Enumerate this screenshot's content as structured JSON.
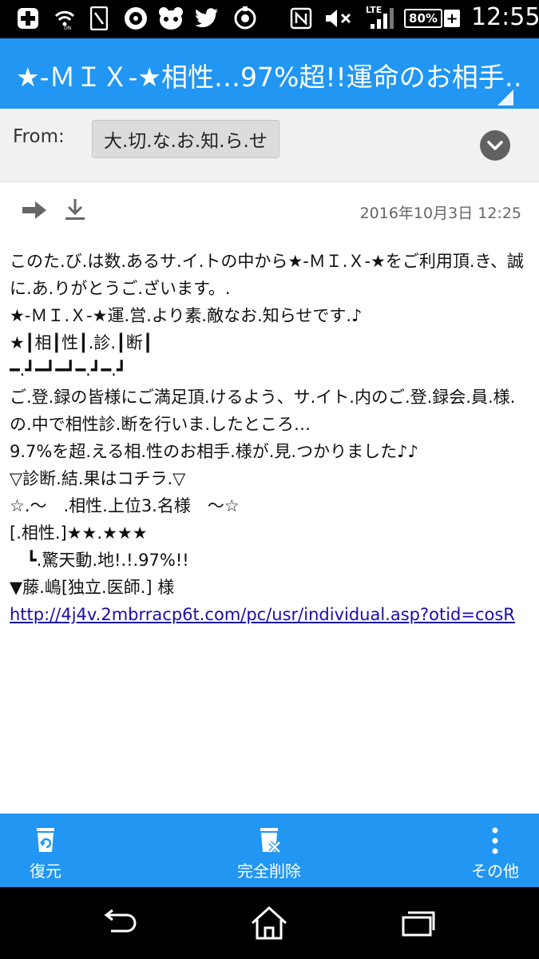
{
  "status_bar": {
    "time": "12:55",
    "battery": "80%",
    "network": "LTE",
    "icons": [
      "plus-icon",
      "wifi-on-icon",
      "sim-card-icon",
      "app-icon",
      "panda-icon",
      "twitter-icon",
      "sync-icon",
      "nfc-icon",
      "mute-icon",
      "signal-icon",
      "battery-icon",
      "charging-icon"
    ]
  },
  "header": {
    "subject": "★-ＭＩＸ-★相性…97%超!!運命のお相手…"
  },
  "from": {
    "label": "From:",
    "sender": "大.切.な.お.知.ら.せ"
  },
  "meta": {
    "date": "2016年10月3日 12:25"
  },
  "body": {
    "lines": [
      "このた.び.は数.あるサ.イ.トの中から★-ＭＩ.Ｘ-★をご利用頂.き、誠に.あ.りがとうご.ざいます。.",
      "",
      "★-ＭＩ.Ｘ-★運.営.より素.敵なお.知らせです.♪",
      "",
      "★┃相┃性┃.診.┃断┃",
      "━.┛━┛━┛━.┛━.┛",
      "",
      "ご.登.録の皆様にご満足頂.けるよう、サ.イト.内のご.登.録会.員.様.の.中で相性診.断を行いま.したところ…",
      "",
      "9.7%を超.える相.性のお相手.様が.見.つかりました♪♪",
      "",
      "",
      "▽診断.結.果はコチラ.▽",
      "",
      "☆.～　.相性.上位3.名様　～☆",
      "",
      "[.相性.]★★.★★★",
      "　┗.驚天動.地!.!.97%!!",
      "▼藤.嶋[独立.医師.] 様"
    ],
    "link": "http://4j4v.2mbrracp6t.com/pc/usr/individual.asp?otid=cosR"
  },
  "actions": {
    "restore": "復元",
    "delete_forever": "完全削除",
    "more": "その他"
  },
  "colors": {
    "accent": "#2196f3",
    "status_bar": "#000000"
  }
}
